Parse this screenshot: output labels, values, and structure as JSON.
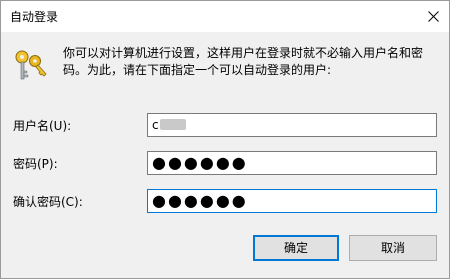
{
  "window": {
    "title": "自动登录"
  },
  "description": {
    "line1": "你可以对计算机进行设置，这样用户在登录时就不必输入用户名和密",
    "line2": "码。为此，请在下面指定一个可以自动登录的用户:"
  },
  "fields": {
    "username": {
      "label": "用户名(U):",
      "value": "c"
    },
    "password": {
      "label": "密码(P):",
      "value": "●●●●●●"
    },
    "confirm": {
      "label": "确认密码(C):",
      "value": "●●●●●●"
    }
  },
  "buttons": {
    "ok": "确定",
    "cancel": "取消"
  },
  "colors": {
    "accent": "#0078d7",
    "dialog_bg": "#f0f0f0"
  }
}
